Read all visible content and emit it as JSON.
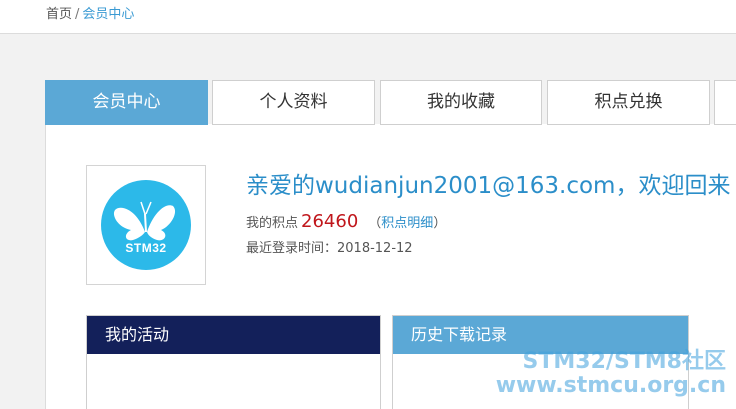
{
  "breadcrumb": {
    "home": "首页",
    "separator": "/",
    "current": "会员中心"
  },
  "tabs": [
    {
      "label": "会员中心",
      "active": true
    },
    {
      "label": "个人资料",
      "active": false
    },
    {
      "label": "我的收藏",
      "active": false
    },
    {
      "label": "积点兑换",
      "active": false
    },
    {
      "label": "",
      "active": false
    }
  ],
  "profile": {
    "avatar_text": "STM32",
    "avatar_icon": "butterfly-logo",
    "welcome": "亲爱的wudianjun2001@163.com，欢迎回来",
    "points_label": "我的积点",
    "points_value": "26460",
    "paren_open": "（",
    "points_detail_link": "积点明细",
    "paren_close": "）",
    "last_login_label": "最近登录时间：",
    "last_login_value": "2018-12-12"
  },
  "panels": {
    "activity_title": "我的活动",
    "history_title": "历史下载记录"
  },
  "watermark": {
    "line1": "STM32/STM8社区",
    "line2": "www.stmcu.org.cn"
  },
  "colors": {
    "tab_active": "#5ba8d6",
    "link": "#2b8ec9",
    "points": "#c0161b",
    "activity_header": "#13205a",
    "history_header": "#5ba8d6",
    "avatar_bg": "#2cb9e9"
  }
}
